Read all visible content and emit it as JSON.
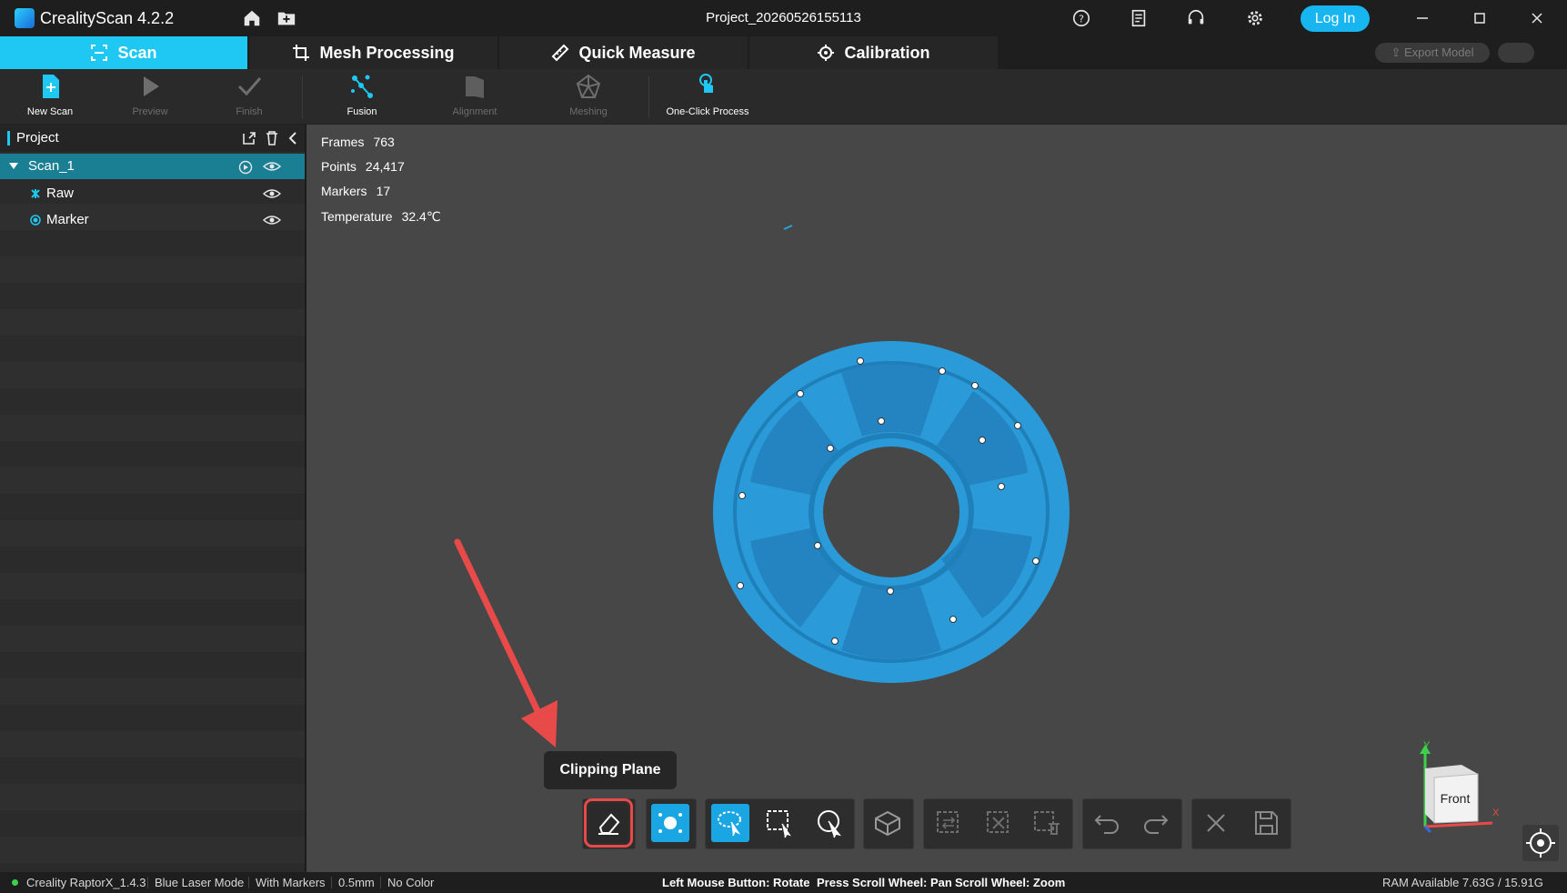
{
  "app": {
    "title": "CrealityScan 4.2.2",
    "project_name": "Project_20260526155113",
    "login_label": "Log In"
  },
  "tabs": [
    {
      "label": "Scan",
      "icon": "scan-frame-icon",
      "active": true
    },
    {
      "label": "Mesh Processing",
      "icon": "crop-icon",
      "active": false
    },
    {
      "label": "Quick Measure",
      "icon": "ruler-icon",
      "active": false
    },
    {
      "label": "Calibration",
      "icon": "target-icon",
      "active": false
    }
  ],
  "export": {
    "label": "Export Model"
  },
  "toolbar": {
    "new_scan": "New Scan",
    "preview": "Preview",
    "finish": "Finish",
    "fusion": "Fusion",
    "alignment": "Alignment",
    "meshing": "Meshing",
    "one_click": "One-Click Process"
  },
  "project": {
    "title": "Project",
    "items": [
      {
        "label": "Scan_1",
        "selected": true
      },
      {
        "label": "Raw",
        "selected": false
      },
      {
        "label": "Marker",
        "selected": false
      }
    ]
  },
  "stats": {
    "frames_label": "Frames",
    "frames": "763",
    "points_label": "Points",
    "points": "24,417",
    "markers_label": "Markers",
    "markers": "17",
    "temp_label": "Temperature",
    "temp": "32.4℃"
  },
  "tooltip": "Clipping Plane",
  "view_cube": {
    "face": "Front",
    "axis_x": "X",
    "axis_y": "Y"
  },
  "colors": {
    "accent": "#1ec8f2",
    "scan_blue": "#2aa0dd",
    "highlight": "#e84a4a"
  },
  "status": {
    "device": "Creality RaptorX_1.4.3",
    "mode": "Blue Laser Mode",
    "markers": "With Markers",
    "resolution": "0.5mm",
    "color": "No Color",
    "hint_rotate": "Left Mouse Button: Rotate",
    "hint_pan": "Press Scroll Wheel: Pan",
    "hint_zoom": "Scroll Wheel: Zoom",
    "ram": "RAM Available 7.63G / 15.91G"
  }
}
